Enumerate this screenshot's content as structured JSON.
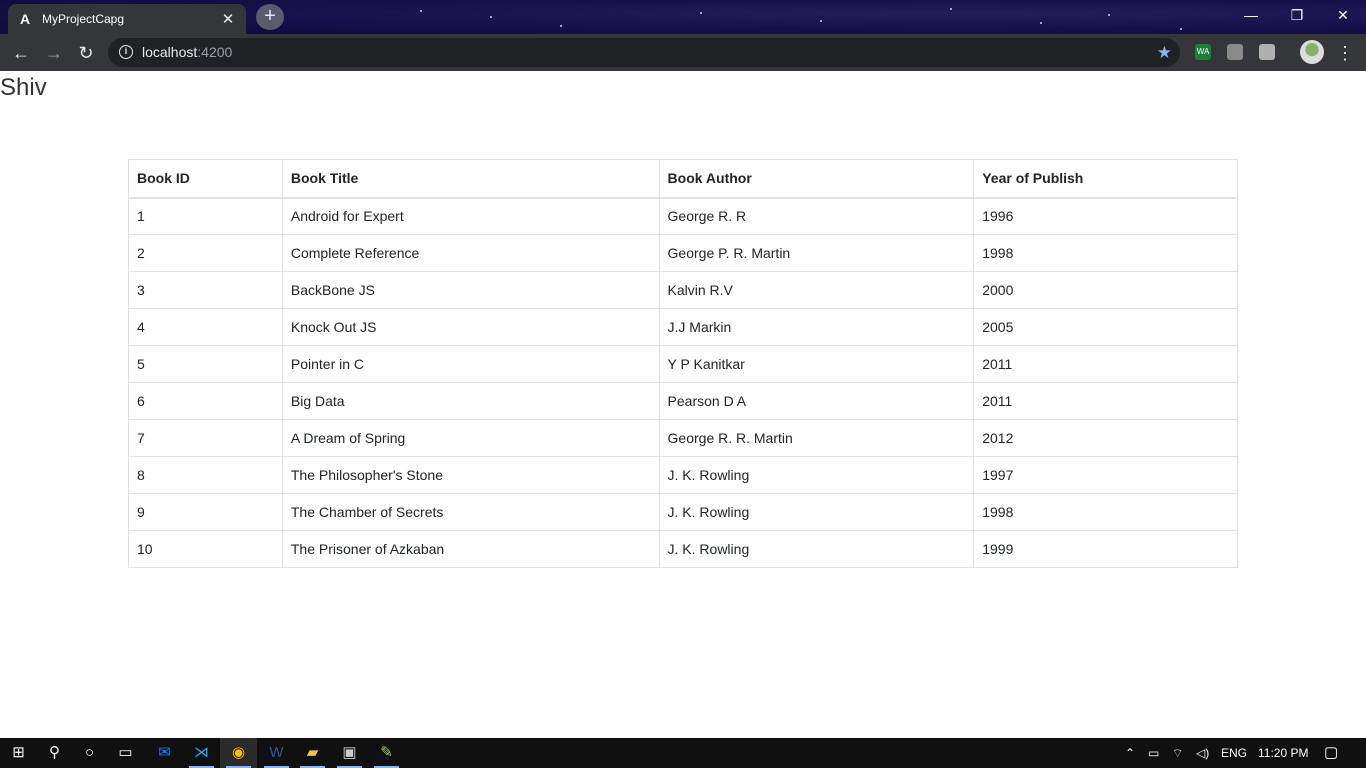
{
  "browser": {
    "tab_title": "MyProjectCapg",
    "tab_favicon": "A",
    "url_host": "localhost",
    "url_port": ":4200"
  },
  "page": {
    "heading": "Shiv",
    "table": {
      "headers": [
        "Book ID",
        "Book Title",
        "Book Author",
        "Year of Publish"
      ],
      "rows": [
        [
          "1",
          "Android for Expert",
          "George R. R",
          "1996"
        ],
        [
          "2",
          "Complete Reference",
          "George P. R. Martin",
          "1998"
        ],
        [
          "3",
          "BackBone JS",
          "Kalvin R.V",
          "2000"
        ],
        [
          "4",
          "Knock Out JS",
          "J.J Markin",
          "2005"
        ],
        [
          "5",
          "Pointer in C",
          "Y P Kanitkar",
          "2011"
        ],
        [
          "6",
          "Big Data",
          "Pearson D A",
          "2011"
        ],
        [
          "7",
          "A Dream of Spring",
          "George R. R. Martin",
          "2012"
        ],
        [
          "8",
          "The Philosopher's Stone",
          "J. K. Rowling",
          "1997"
        ],
        [
          "9",
          "The Chamber of Secrets",
          "J. K. Rowling",
          "1998"
        ],
        [
          "10",
          "The Prisoner of Azkaban",
          "J. K. Rowling",
          "1999"
        ]
      ]
    }
  },
  "taskbar": {
    "language": "ENG",
    "time": "11:20 PM"
  }
}
